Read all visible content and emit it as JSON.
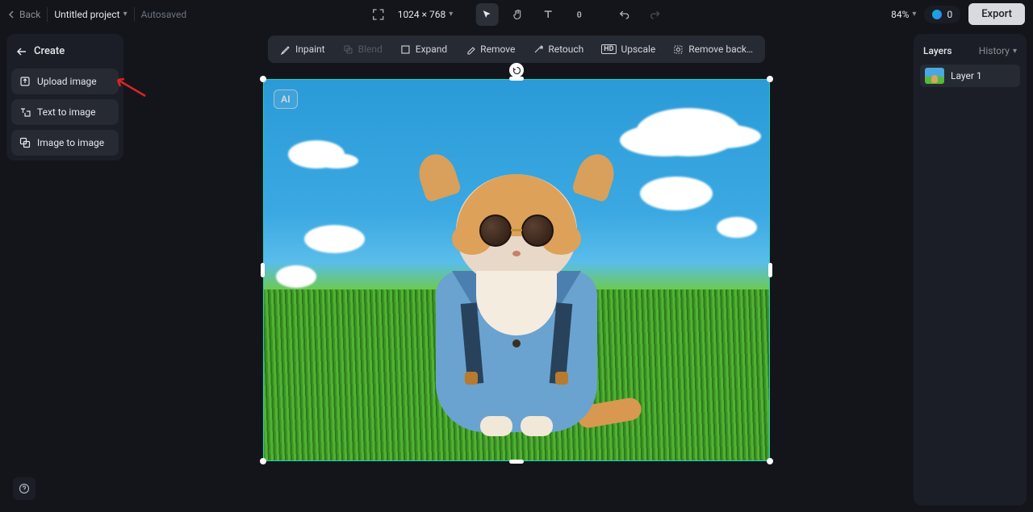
{
  "topbar": {
    "back": "Back",
    "project_title": "Untitled project",
    "autosaved": "Autosaved",
    "canvas_size": "1024 × 768",
    "zoom": "84%",
    "credits": "0",
    "export": "Export"
  },
  "left_panel": {
    "create": "Create",
    "upload_image": "Upload image",
    "text_to_image": "Text to image",
    "image_to_image": "Image to image"
  },
  "edit_toolbar": {
    "inpaint": "Inpaint",
    "blend": "Blend",
    "expand": "Expand",
    "remove": "Remove",
    "retouch": "Retouch",
    "upscale": "Upscale",
    "remove_bg": "Remove back…"
  },
  "canvas": {
    "ai_badge": "AI"
  },
  "right_panel": {
    "layers": "Layers",
    "history": "History",
    "layer1": "Layer 1"
  }
}
